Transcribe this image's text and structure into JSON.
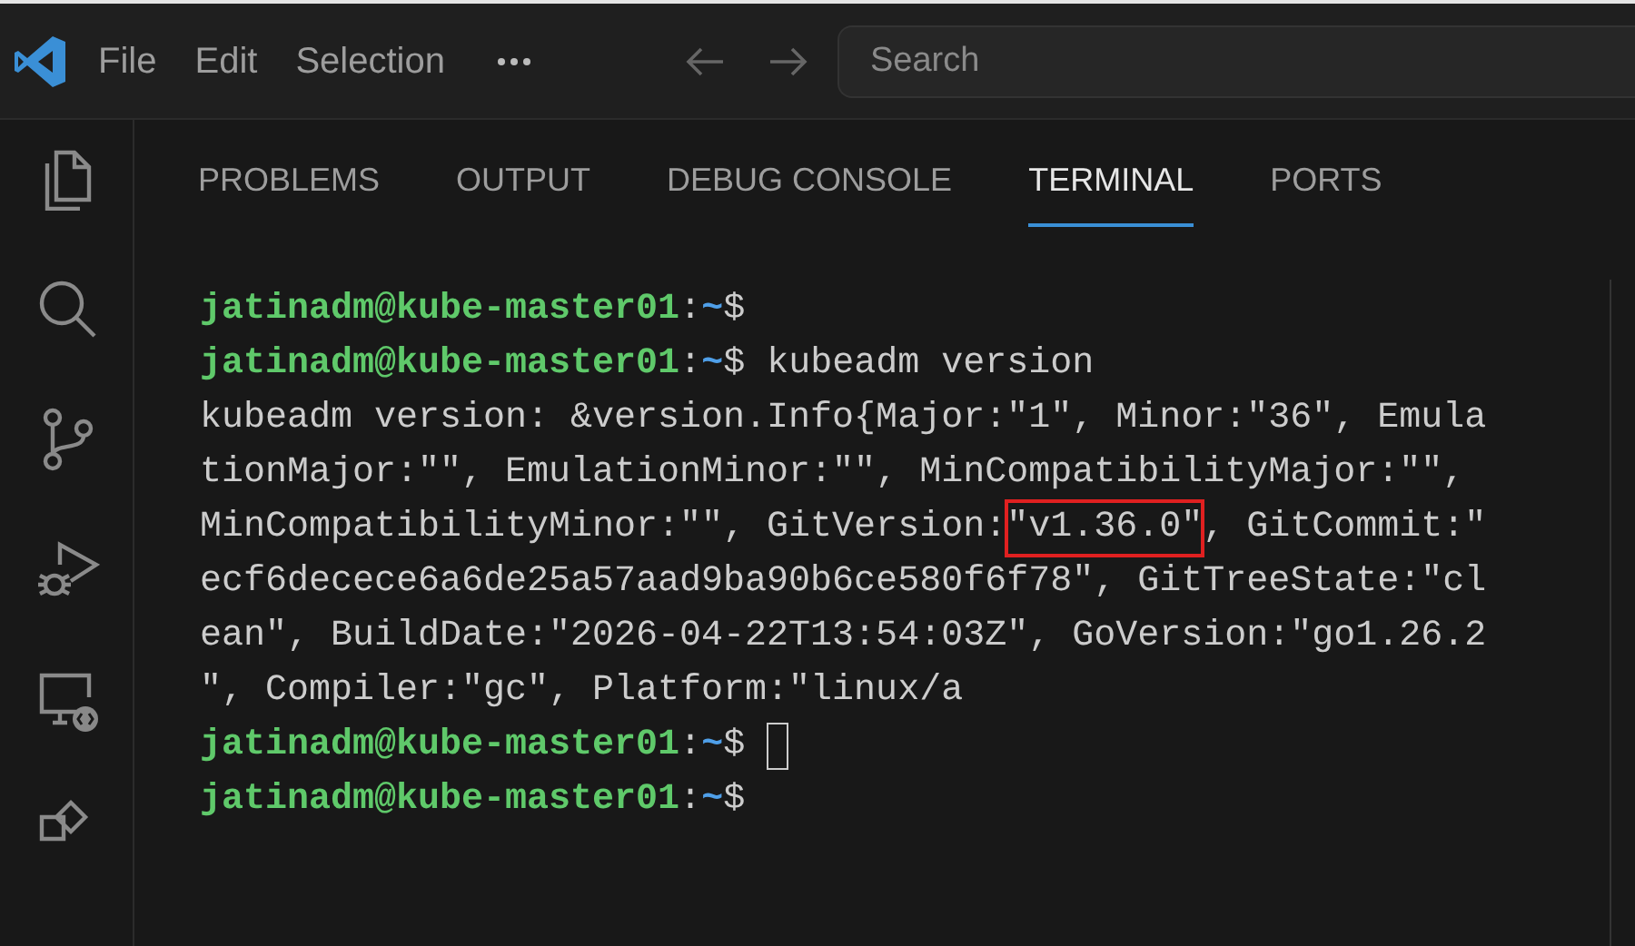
{
  "menu": [
    "File",
    "Edit",
    "Selection"
  ],
  "search": {
    "placeholder": "Search"
  },
  "activity_bar": [
    {
      "kind": "files"
    },
    {
      "kind": "search"
    },
    {
      "kind": "source-control"
    },
    {
      "kind": "debug"
    },
    {
      "kind": "remote"
    },
    {
      "kind": "extensions"
    }
  ],
  "panel_tabs": [
    {
      "label": "PROBLEMS",
      "selected": false
    },
    {
      "label": "OUTPUT",
      "selected": false
    },
    {
      "label": "DEBUG CONSOLE",
      "selected": false
    },
    {
      "label": "TERMINAL",
      "selected": true
    },
    {
      "label": "PORTS",
      "selected": false
    }
  ],
  "terminal_lines": [
    {
      "kind": "prompt",
      "user": "jatinadm@kube-master01",
      "separator": ":",
      "path": "~",
      "symbol": "$",
      "cursor": false
    },
    {
      "kind": "prompt",
      "user": "jatinadm@kube-master01",
      "separator": ":",
      "path": "~",
      "symbol": "$",
      "command": "kubeadm version",
      "cursor": false
    },
    {
      "kind": "output",
      "segments": [
        {
          "text": "kubeadm version: &version.Info{Major:\"1\", Minor:\"36\", Emula",
          "highlighted": false
        }
      ]
    },
    {
      "kind": "output",
      "segments": [
        {
          "text": "tionMajor:\"\", EmulationMinor:\"\", MinCompatibilityMajor:\"\",",
          "highlighted": false
        }
      ]
    },
    {
      "kind": "output",
      "segments": [
        {
          "text": "MinCompatibilityMinor:\"\", GitVersion:",
          "highlighted": false
        },
        {
          "text": "\"v1.36.0\"",
          "highlighted": true
        },
        {
          "text": ", GitCommit:\"",
          "highlighted": false
        }
      ]
    },
    {
      "kind": "output",
      "segments": [
        {
          "text": "ecf6decece6a6de25a57aad9ba90b6ce580f6f78\", GitTreeState:\"cl",
          "highlighted": false
        }
      ]
    },
    {
      "kind": "output",
      "segments": [
        {
          "text": "ean\", BuildDate:\"2026-04-22T13:54:03Z\", GoVersion:\"go1.26.2",
          "highlighted": false
        }
      ]
    },
    {
      "kind": "output",
      "segments": [
        {
          "text": "\", Compiler:\"gc\", Platform:\"linux/a",
          "highlighted": false
        }
      ]
    },
    {
      "kind": "prompt",
      "user": "jatinadm@kube-master01",
      "separator": ":",
      "path": "~",
      "symbol": "$",
      "cursor": true
    },
    {
      "kind": "prompt",
      "user": "jatinadm@kube-master01",
      "separator": ":",
      "path": "~",
      "symbol": "$",
      "cursor": false
    }
  ]
}
